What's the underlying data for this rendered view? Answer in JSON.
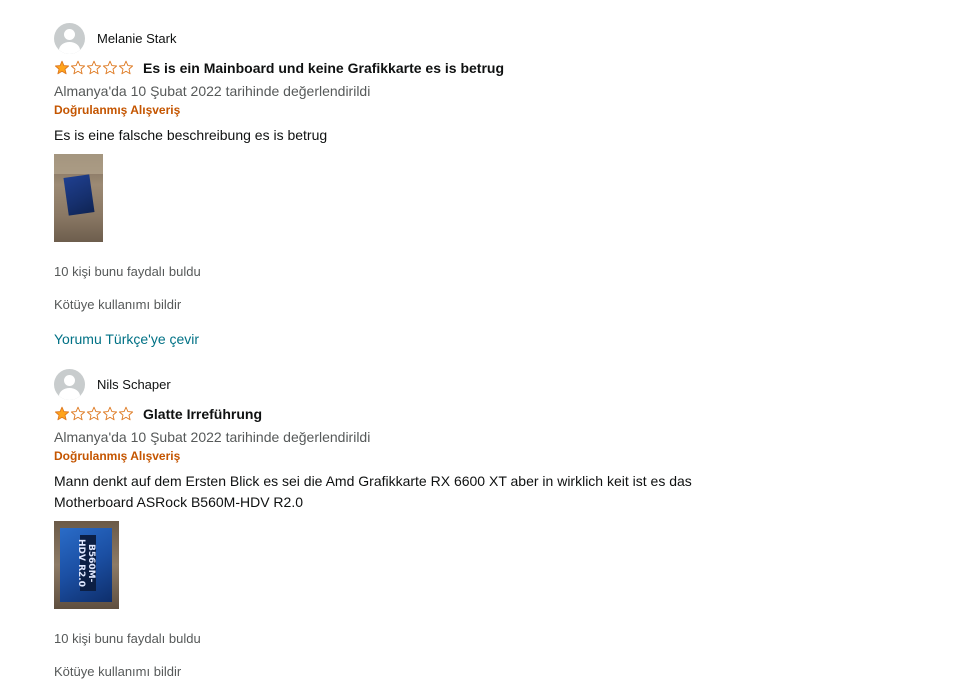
{
  "reviews": [
    {
      "author": "Melanie Stark",
      "rating": 1,
      "max_rating": 5,
      "title": "Es is ein Mainboard und keine Grafikkarte es is betrug",
      "date": "Almanya'da 10 Şubat 2022 tarihinde değerlendirildi",
      "verified": "Doğrulanmış Alışveriş",
      "body": "Es is eine falsche beschreibung es is betrug",
      "helpful": "10 kişi bunu faydalı buldu",
      "report": "Kötüye kullanımı bildir",
      "translate": "Yorumu Türkçe'ye çevir"
    },
    {
      "author": "Nils Schaper",
      "rating": 1,
      "max_rating": 5,
      "title": "Glatte Irreführung",
      "date": "Almanya'da 10 Şubat 2022 tarihinde değerlendirildi",
      "verified": "Doğrulanmış Alışveriş",
      "body_line1": "Mann denkt auf dem Ersten Blick es sei die Amd Grafikkarte RX 6600 XT aber in wirklich keit ist es das",
      "body_line2": "Motherboard ASRock B560M-HDV R2.0",
      "image_text": "B560M-HDV R2.0",
      "helpful": "10 kişi bunu faydalı buldu",
      "report": "Kötüye kullanımı bildir"
    }
  ],
  "colors": {
    "star_fill": "#ffa41c",
    "star_outline": "#de7921",
    "verified": "#c45500",
    "link": "#007185",
    "secondary_text": "#565959"
  }
}
